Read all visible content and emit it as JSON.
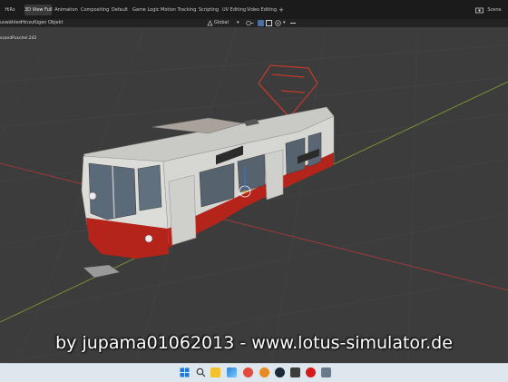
{
  "workspace_tabs": [
    {
      "label": "HiRs",
      "active": false
    },
    {
      "label": "3D View Full",
      "active": true
    },
    {
      "label": "Animation",
      "active": false
    },
    {
      "label": "Compositing",
      "active": false
    },
    {
      "label": "Default",
      "active": false
    },
    {
      "label": "Game Logic",
      "active": false
    },
    {
      "label": "Motion Tracking",
      "active": false
    },
    {
      "label": "Scripting",
      "active": false
    },
    {
      "label": "UV Editing",
      "active": false
    },
    {
      "label": "Video Editing",
      "active": false
    }
  ],
  "add_tab_symbol": "+",
  "scene_label": "Scene",
  "header_menu": [
    "uswählen",
    "Hinzufügen",
    "Objekt"
  ],
  "transform_orientation": "Global",
  "viewport_label": "ssandPuschel.242",
  "watermark": "by jupama01062013 - www.lotus-simulator.de",
  "taskbar_icons": [
    "windows-start-icon",
    "search-icon",
    "file-explorer-icon",
    "photos-icon",
    "chrome-icon",
    "app-icon",
    "steam-icon",
    "terminal-icon",
    "red-app-icon",
    "network-icon"
  ],
  "colors": {
    "tram_body": "#d8d8d4",
    "tram_red": "#b4241b",
    "grid_x": "#a63a3a",
    "grid_y": "#7d9a33",
    "topbar": "#1b1b1b",
    "taskbar": "#dfe7ee"
  }
}
